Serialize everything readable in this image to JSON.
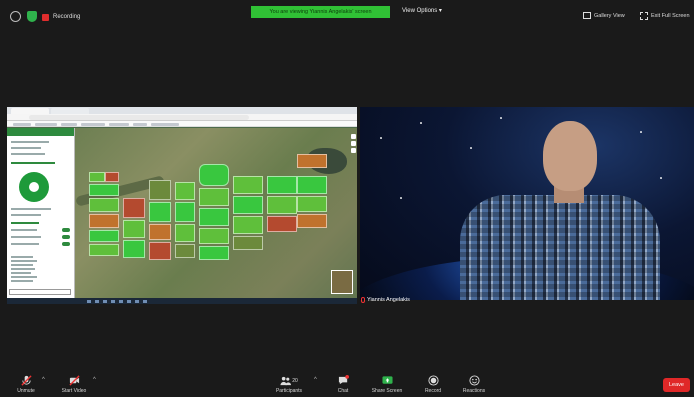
{
  "topbar": {
    "recording_label": "Recording",
    "banner_text": "You are viewing Yiannis Angelakis' screen",
    "view_options_label": "View Options ▾",
    "gallery_view_label": "Gallery View",
    "exit_full_screen_label": "Exit Full Screen"
  },
  "camera": {
    "participant_name": "Yiannis Angelakis"
  },
  "toolbar": {
    "unmute_label": "Unmute",
    "start_video_label": "Start Video",
    "participants_label": "Participants",
    "participants_count": "20",
    "chat_label": "Chat",
    "share_screen_label": "Share Screen",
    "record_label": "Record",
    "reactions_label": "Reactions",
    "leave_label": "Leave"
  },
  "colors": {
    "banner_green": "#30c135",
    "leave_red": "#e02828",
    "share_green": "#2fb24c",
    "field_green_bright": "#39c73f",
    "field_green": "#5fbf3b",
    "field_orange": "#c0722d",
    "field_red": "#b44a2f"
  }
}
